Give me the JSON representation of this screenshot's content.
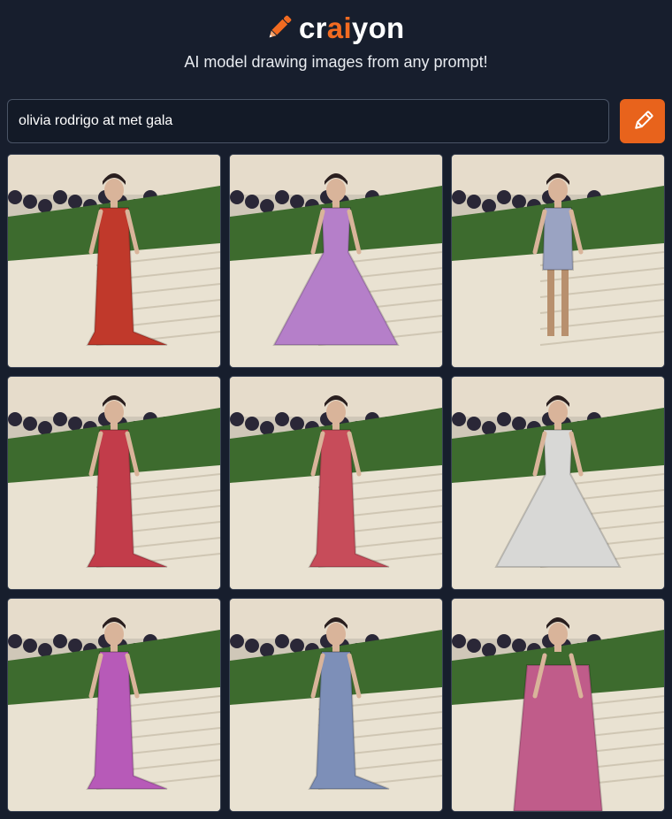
{
  "header": {
    "logo_prefix": "cr",
    "logo_accent": "ai",
    "logo_suffix": "yon",
    "tagline": "AI model drawing images from any prompt!"
  },
  "search": {
    "value": "olivia rodrigo at met gala"
  },
  "colors": {
    "background": "#171e2d",
    "accent": "#e8631c",
    "logo_accent": "#f26b21"
  },
  "icons": {
    "logo": "pencil-icon",
    "draw_button": "pencil-icon"
  },
  "images": [
    {
      "dress": "#c0392b",
      "style": "gown"
    },
    {
      "dress": "#b57fc9",
      "style": "feather"
    },
    {
      "dress": "#9aa3c2",
      "style": "short"
    },
    {
      "dress": "#c23c4a",
      "style": "drape"
    },
    {
      "dress": "#c74c5a",
      "style": "skirt"
    },
    {
      "dress": "#d8d8d6",
      "style": "hoop"
    },
    {
      "dress": "#b75ab8",
      "style": "split"
    },
    {
      "dress": "#7d8fb8",
      "style": "train"
    },
    {
      "dress": "#c05c8a",
      "style": "closeup"
    }
  ]
}
